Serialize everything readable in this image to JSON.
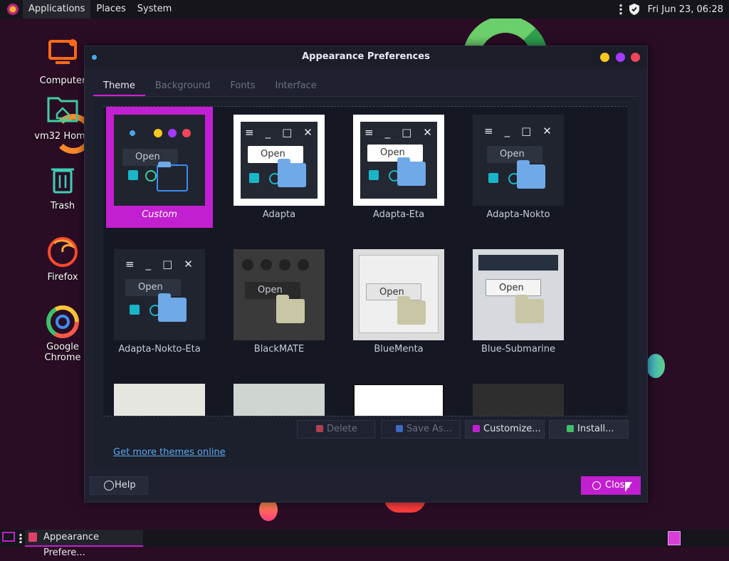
{
  "top_panel": {
    "menus": [
      "Applications",
      "Places",
      "System"
    ],
    "clock": "Fri Jun 23, 06:28"
  },
  "desktop": {
    "icons": [
      {
        "label": "Computer",
        "icon": "computer-icon"
      },
      {
        "label": "vm32 Home",
        "icon": "home-folder-icon"
      },
      {
        "label": "Trash",
        "icon": "trash-icon"
      },
      {
        "label": "Firefox",
        "icon": "firefox-icon"
      },
      {
        "label": "Google Chrome",
        "icon": "chrome-icon"
      }
    ]
  },
  "window": {
    "title": "Appearance Preferences",
    "tabs": [
      "Theme",
      "Background",
      "Fonts",
      "Interface"
    ],
    "active_tab": "Theme",
    "themes": [
      {
        "name": "Custom",
        "selected": true
      },
      {
        "name": "Adapta"
      },
      {
        "name": "Adapta-Eta"
      },
      {
        "name": "Adapta-Nokto"
      },
      {
        "name": "Adapta-Nokto-Eta"
      },
      {
        "name": "BlackMATE"
      },
      {
        "name": "BlueMenta"
      },
      {
        "name": "Blue-Submarine"
      }
    ],
    "preview_open_label": "Open",
    "buttons": {
      "delete": "Delete",
      "save_as": "Save As...",
      "customize": "Customize...",
      "install": "Install..."
    },
    "link": "Get more themes online",
    "help": "Help",
    "close": "Close"
  },
  "taskbar": {
    "task": "Appearance Prefere..."
  },
  "colors": {
    "accent": "#c21fd0",
    "window_bg": "#1f2130",
    "panel_bg": "#15151b",
    "desktop_bg": "#2a0d25"
  }
}
